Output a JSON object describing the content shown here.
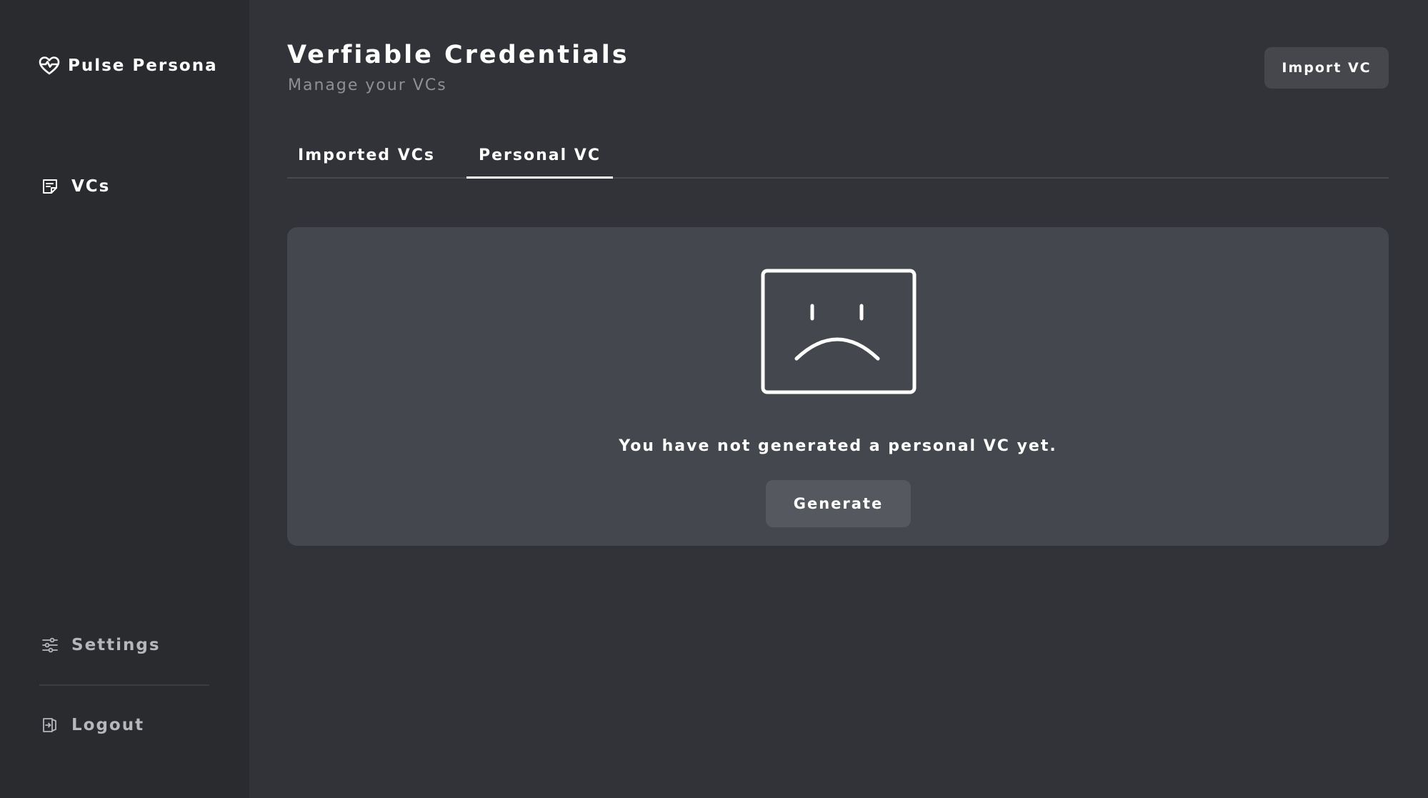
{
  "sidebar": {
    "brand": {
      "name": "Pulse Persona",
      "icon": "heart-pulse-icon"
    },
    "nav": [
      {
        "label": "VCs",
        "icon": "document-icon",
        "active": true
      }
    ],
    "footer": [
      {
        "label": "Settings",
        "icon": "sliders-icon"
      },
      {
        "label": "Logout",
        "icon": "logout-icon"
      }
    ]
  },
  "header": {
    "title": "Verfiable Credentials",
    "subtitle": "Manage your VCs",
    "import_button": "Import VC"
  },
  "tabs": [
    {
      "label": "Imported VCs",
      "active": false
    },
    {
      "label": "Personal VC",
      "active": true
    }
  ],
  "empty_state": {
    "icon": "sad-face-icon",
    "message": "You have not generated a personal VC yet.",
    "button": "Generate"
  },
  "colors": {
    "background": "#323338",
    "sidebar": "#2a2b2f",
    "panel": "#44474e",
    "button": "#45474d",
    "muted_text": "#8e9096"
  }
}
